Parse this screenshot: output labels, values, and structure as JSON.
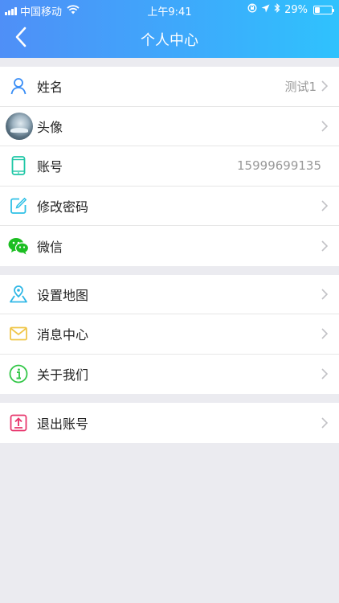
{
  "status_bar": {
    "carrier": "中国移动",
    "time": "上午9:41",
    "battery": "29%",
    "battery_level": 0.29
  },
  "nav": {
    "title": "个人中心",
    "back_icon": "chevron-left-icon"
  },
  "groups": [
    {
      "items": [
        {
          "label": "姓名",
          "value": "测试1",
          "icon": "user-icon",
          "color": "#3a8ef6"
        },
        {
          "label": "头像",
          "value": "",
          "icon": "avatar"
        },
        {
          "label": "账号",
          "value": "15999699135",
          "icon": "phone-icon",
          "color": "#1fc7a6"
        },
        {
          "label": "修改密码",
          "value": "",
          "icon": "edit-icon",
          "color": "#2fc0e6"
        },
        {
          "label": "微信",
          "value": "",
          "icon": "wechat-icon",
          "color": "#1cbe22"
        }
      ]
    },
    {
      "items": [
        {
          "label": "设置地图",
          "value": "",
          "icon": "map-pin-icon",
          "color": "#2fb7e6"
        },
        {
          "label": "消息中心",
          "value": "",
          "icon": "mail-icon",
          "color": "#f0c64a"
        },
        {
          "label": "关于我们",
          "value": "",
          "icon": "info-icon",
          "color": "#35c74a"
        }
      ]
    },
    {
      "items": [
        {
          "label": "退出账号",
          "value": "",
          "icon": "logout-icon",
          "color": "#e8386e"
        }
      ]
    }
  ],
  "colors": {
    "header_start": "#4f8ff7",
    "header_end": "#2fc2fd",
    "background": "#ebebf0"
  }
}
